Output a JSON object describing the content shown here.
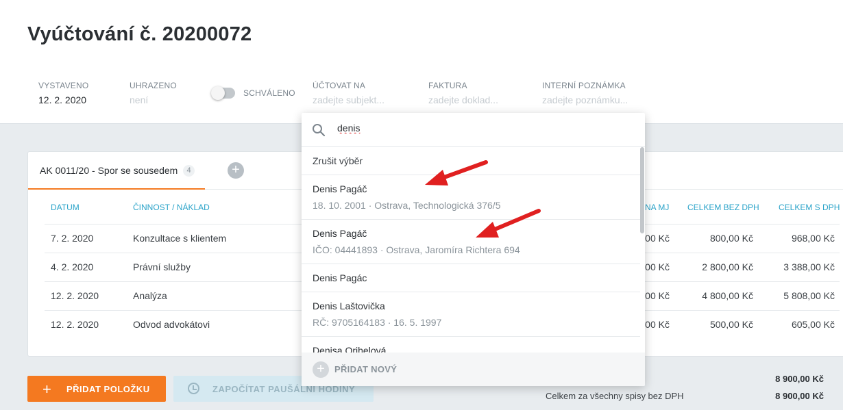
{
  "page": {
    "title": "Vyúčtování č. 20200072"
  },
  "meta": {
    "vystaveno": {
      "label": "VYSTAVENO",
      "value": "12. 2. 2020"
    },
    "uhrazeno": {
      "label": "UHRAZENO",
      "value": "není"
    },
    "schvaleno": {
      "label": "SCHVÁLENO",
      "on": false
    },
    "uctovat_na": {
      "label": "ÚČTOVAT NA",
      "placeholder": "zadejte subjekt..."
    },
    "faktura": {
      "label": "FAKTURA",
      "placeholder": "zadejte doklad..."
    },
    "poznamka": {
      "label": "INTERNÍ POZNÁMKA",
      "placeholder": "zadejte poznámku..."
    }
  },
  "tabs": [
    {
      "label": "AK 0011/20 - Spor se sousedem",
      "badge": "4",
      "active": true
    }
  ],
  "table": {
    "headers": {
      "datum": "DATUM",
      "cinnost": "ČINNOST / NÁKLAD",
      "cena_mj": "NA MJ",
      "bez_dph": "CELKEM BEZ DPH",
      "s_dph": "CELKEM S DPH"
    },
    "rows": [
      {
        "datum": "7. 2. 2020",
        "cinnost": "Konzultace s klientem",
        "cena_mj": ",00 Kč",
        "bez_dph": "800,00 Kč",
        "s_dph": "968,00 Kč"
      },
      {
        "datum": "4. 2. 2020",
        "cinnost": "Právní služby",
        "cena_mj": ",00 Kč",
        "bez_dph": "2 800,00 Kč",
        "s_dph": "3 388,00 Kč"
      },
      {
        "datum": "12. 2. 2020",
        "cinnost": "Analýza",
        "cena_mj": ",00 Kč",
        "bez_dph": "4 800,00 Kč",
        "s_dph": "5 808,00 Kč"
      },
      {
        "datum": "12. 2. 2020",
        "cinnost": "Odvod advokátovi",
        "cena_mj": ",00 Kč",
        "bez_dph": "500,00 Kč",
        "s_dph": "605,00 Kč"
      }
    ]
  },
  "actions": {
    "add_item": "PŘIDAT POLOŽKU",
    "add_hours": "ZAPOČÍTAT PAUŠÁLNÍ HODINY"
  },
  "totals": {
    "total_1": "8 900,00 Kč",
    "all_files_label": "Celkem za všechny spisy bez DPH",
    "all_files_value": "8 900,00 Kč"
  },
  "dropdown": {
    "search_value": "denis",
    "cancel_label": "Zrušit výběr",
    "options": [
      {
        "name": "Denis Pagáč",
        "sub": "18. 10. 2001 · Ostrava, Technologická 376/5"
      },
      {
        "name": "Denis Pagáč",
        "sub": "IČO: 04441893 · Ostrava, Jaromíra Richtera 694"
      },
      {
        "name": "Denis Pagác",
        "sub": ""
      },
      {
        "name": "Denis Laštovička",
        "sub": "RČ: 9705164183 · 16. 5. 1997"
      },
      {
        "name": "Denisa Orihelová",
        "sub": ""
      }
    ],
    "add_new_label": "PŘIDAT NOVÝ"
  },
  "colors": {
    "accent_orange": "#f47920",
    "header_teal": "#2aa3c9",
    "annotation_red": "#e02020"
  }
}
